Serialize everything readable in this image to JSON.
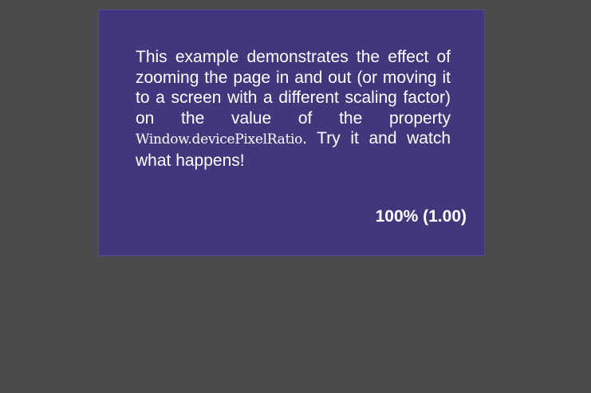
{
  "panel": {
    "text_before": "This example demonstrates the effect of zooming the page in and out (or moving it to a screen with a different scaling factor) on the value of the property ",
    "code": "Window.devicePixelRatio",
    "text_after": ". Try it and watch what happens!",
    "ratio_display": "100% (1.00)"
  },
  "colors": {
    "page_background": "#4a4b4c",
    "panel_background": "#43367d",
    "panel_border": "#5547a0",
    "text": "#ffffff"
  }
}
